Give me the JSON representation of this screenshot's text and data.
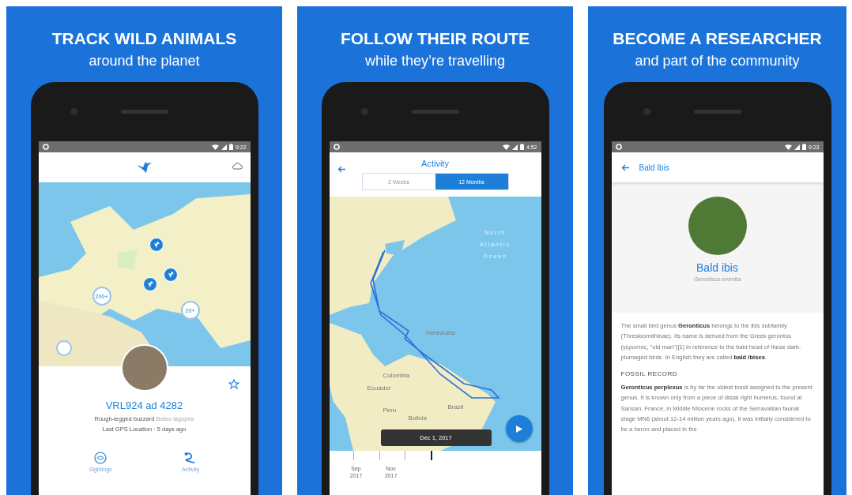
{
  "panels": [
    {
      "headline": "TRACK WILD ANIMALS",
      "subhead": "around the planet",
      "screen": {
        "kind": "tracker",
        "time": "9:22",
        "clusters": [
          "200+",
          "20+"
        ],
        "animal": {
          "name": "VRL924 ad 4282",
          "common": "Rough-legged buzzard",
          "latin": "Buteo lagopus",
          "last_seen": "Last GPS Location · 5 days ago",
          "starred": false
        },
        "nav": [
          {
            "label": "Sightings",
            "kind": "sightings"
          },
          {
            "label": "Activity",
            "kind": "activity"
          }
        ]
      }
    },
    {
      "headline": "FOLLOW THEIR ROUTE",
      "subhead": "while they’re travelling",
      "screen": {
        "kind": "activity",
        "time": "4:52",
        "title": "Activity",
        "tabs": [
          {
            "label": "2 Weeks",
            "selected": false
          },
          {
            "label": "12 Months",
            "selected": true
          }
        ],
        "ocean_label": "North Atlantic Ocean",
        "countries": [
          "Venezuela",
          "Colombia",
          "Ecuador",
          "Peru",
          "Brazil",
          "Bolivia"
        ],
        "tooltip": "Dec 1, 2017",
        "timeline": [
          "Sep 2017",
          "Nov 2017"
        ]
      }
    },
    {
      "headline": "BECOME A RESEARCHER",
      "subhead": "and part of the community",
      "screen": {
        "kind": "species",
        "time": "9:23",
        "title": "Bald Ibis",
        "name": "Bald ibis",
        "latin": "Geronticus eremita",
        "sections": [
          {
            "text": "The small bird genus **Geronticus** belongs to the ibis subfamily (Threskiornithinae). Its name is derived from the Greek gerontos (γέροντος, \"old man\")[1] in reference to the bald head of these dark-plumaged birds. In English they are called **bald ibises**."
          },
          {
            "heading": "FOSSIL RECORD",
            "text": "**Geronticus perplexus** is by far the oldest fossil assigned to the present genus. It is known only from a piece of distal right humerus, found at Sansan, France, in Middle Miocene rocks of the Serravallian faunal stage MN6 (about 12-14 million years ago). It was initially considered to be a heron and placed in the"
          }
        ]
      }
    }
  ]
}
